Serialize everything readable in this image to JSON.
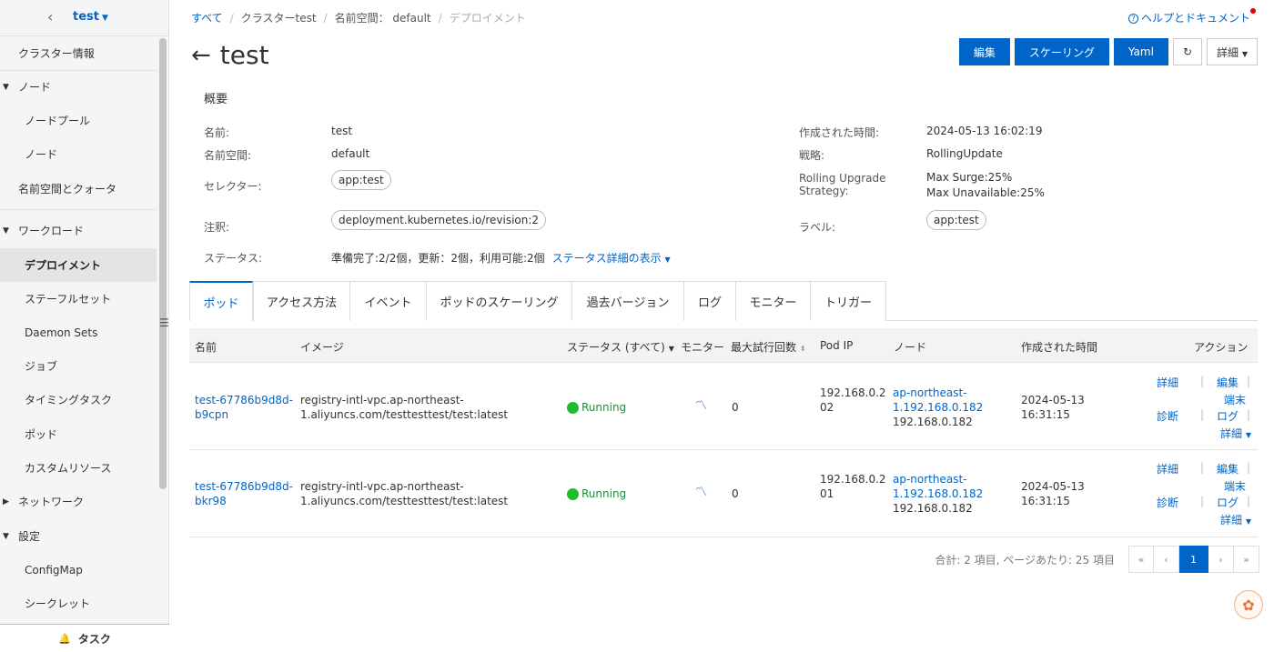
{
  "sidebar": {
    "back_icon": "chevron-left-icon",
    "cluster_name": "test",
    "items": [
      {
        "label": "クラスター情報"
      },
      {
        "label": "ノード"
      },
      {
        "label": "ノードプール"
      },
      {
        "label": "ノード"
      },
      {
        "label": "名前空間とクォータ"
      },
      {
        "label": "ワークロード"
      },
      {
        "label": "デプロイメント"
      },
      {
        "label": "ステーフルセット"
      },
      {
        "label": "Daemon Sets"
      },
      {
        "label": "ジョブ"
      },
      {
        "label": "タイミングタスク"
      },
      {
        "label": "ポッド"
      },
      {
        "label": "カスタムリソース"
      },
      {
        "label": "ネットワーク"
      },
      {
        "label": "設定"
      },
      {
        "label": "ConfigMap"
      },
      {
        "label": "シークレット"
      }
    ],
    "task_label": "タスク"
  },
  "breadcrumb": {
    "all": "すべて",
    "cluster": "クラスターtest",
    "namespace": "名前空間： default",
    "current": "デプロイメント"
  },
  "help_label": "ヘルプとドキュメント",
  "page_title": "test",
  "toolbar": {
    "edit": "編集",
    "scaling": "スケーリング",
    "yaml": "Yaml",
    "refresh": "↻",
    "details": "詳細"
  },
  "overview": {
    "title": "概要",
    "name_label": "名前:",
    "name_value": "test",
    "namespace_label": "名前空間:",
    "namespace_value": "default",
    "selector_label": "セレクター:",
    "selector_value": "app:test",
    "annotation_label": "注釈:",
    "annotation_value": "deployment.kubernetes.io/revision:2",
    "status_label": "ステータス:",
    "status_value": "準備完了:2/2個，更新：2個，利用可能:2個",
    "status_link": "ステータス詳細の表示",
    "created_label": "作成された時間:",
    "created_value": "2024-05-13 16:02:19",
    "strategy_label": "戦略:",
    "strategy_value": "RollingUpdate",
    "rolling_label_1": "Rolling Upgrade",
    "rolling_label_2": "Strategy:",
    "max_surge": "Max Surge:25%",
    "max_unavailable": "Max Unavailable:25%",
    "labels_label": "ラベル:",
    "labels_value": "app:test"
  },
  "tabs": [
    "ポッド",
    "アクセス方法",
    "イベント",
    "ポッドのスケーリング",
    "過去バージョン",
    "ログ",
    "モニター",
    "トリガー"
  ],
  "table": {
    "headers": {
      "name": "名前",
      "image": "イメージ",
      "status": "ステータス (すべて)",
      "monitor": "モニター",
      "retries": "最大試行回数",
      "pod_ip": "Pod IP",
      "node": "ノード",
      "created": "作成された時間",
      "actions": "アクション"
    },
    "rows": [
      {
        "name_1": "test-67786b9d8d-",
        "name_2": "b9cpn",
        "image_1": "registry-intl-vpc.ap-northeast-",
        "image_2": "1.aliyuncs.com/testtesttest/test:latest",
        "status": "Running",
        "retries": "0",
        "ip_1": "192.168.0.2",
        "ip_2": "02",
        "node_1": "ap-northeast-",
        "node_2": "1.192.168.0.182",
        "node_3": "192.168.0.182",
        "created_1": "2024-05-13",
        "created_2": "16:31:15"
      },
      {
        "name_1": "test-67786b9d8d-",
        "name_2": "bkr98",
        "image_1": "registry-intl-vpc.ap-northeast-",
        "image_2": "1.aliyuncs.com/testtesttest/test:latest",
        "status": "Running",
        "retries": "0",
        "ip_1": "192.168.0.2",
        "ip_2": "01",
        "node_1": "ap-northeast-",
        "node_2": "1.192.168.0.182",
        "node_3": "192.168.0.182",
        "created_1": "2024-05-13",
        "created_2": "16:31:15"
      }
    ],
    "actions": {
      "detail": "詳細",
      "edit": "編集",
      "terminal": "端末",
      "diagnose": "診断",
      "log": "ログ",
      "more": "詳細"
    }
  },
  "pagination": {
    "summary": "合計: 2 項目, ページあたり: 25 項目",
    "first": "«",
    "prev": "‹",
    "current": "1",
    "next": "›",
    "last": "»"
  },
  "colors": {
    "primary": "#0064c8",
    "running": "#1fbd2d"
  }
}
